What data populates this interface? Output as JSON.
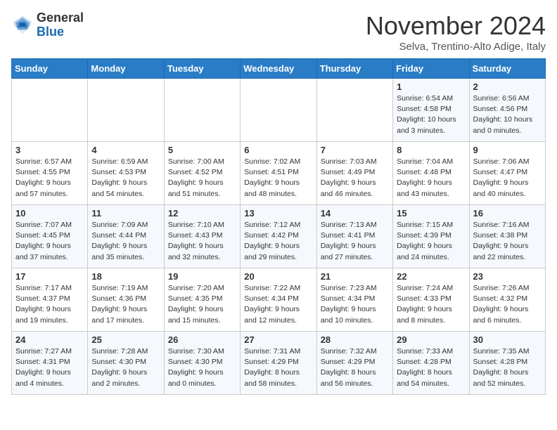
{
  "header": {
    "logo_general": "General",
    "logo_blue": "Blue",
    "month_title": "November 2024",
    "subtitle": "Selva, Trentino-Alto Adige, Italy"
  },
  "weekdays": [
    "Sunday",
    "Monday",
    "Tuesday",
    "Wednesday",
    "Thursday",
    "Friday",
    "Saturday"
  ],
  "weeks": [
    [
      {
        "day": "",
        "info": ""
      },
      {
        "day": "",
        "info": ""
      },
      {
        "day": "",
        "info": ""
      },
      {
        "day": "",
        "info": ""
      },
      {
        "day": "",
        "info": ""
      },
      {
        "day": "1",
        "info": "Sunrise: 6:54 AM\nSunset: 4:58 PM\nDaylight: 10 hours\nand 3 minutes."
      },
      {
        "day": "2",
        "info": "Sunrise: 6:56 AM\nSunset: 4:56 PM\nDaylight: 10 hours\nand 0 minutes."
      }
    ],
    [
      {
        "day": "3",
        "info": "Sunrise: 6:57 AM\nSunset: 4:55 PM\nDaylight: 9 hours\nand 57 minutes."
      },
      {
        "day": "4",
        "info": "Sunrise: 6:59 AM\nSunset: 4:53 PM\nDaylight: 9 hours\nand 54 minutes."
      },
      {
        "day": "5",
        "info": "Sunrise: 7:00 AM\nSunset: 4:52 PM\nDaylight: 9 hours\nand 51 minutes."
      },
      {
        "day": "6",
        "info": "Sunrise: 7:02 AM\nSunset: 4:51 PM\nDaylight: 9 hours\nand 48 minutes."
      },
      {
        "day": "7",
        "info": "Sunrise: 7:03 AM\nSunset: 4:49 PM\nDaylight: 9 hours\nand 46 minutes."
      },
      {
        "day": "8",
        "info": "Sunrise: 7:04 AM\nSunset: 4:48 PM\nDaylight: 9 hours\nand 43 minutes."
      },
      {
        "day": "9",
        "info": "Sunrise: 7:06 AM\nSunset: 4:47 PM\nDaylight: 9 hours\nand 40 minutes."
      }
    ],
    [
      {
        "day": "10",
        "info": "Sunrise: 7:07 AM\nSunset: 4:45 PM\nDaylight: 9 hours\nand 37 minutes."
      },
      {
        "day": "11",
        "info": "Sunrise: 7:09 AM\nSunset: 4:44 PM\nDaylight: 9 hours\nand 35 minutes."
      },
      {
        "day": "12",
        "info": "Sunrise: 7:10 AM\nSunset: 4:43 PM\nDaylight: 9 hours\nand 32 minutes."
      },
      {
        "day": "13",
        "info": "Sunrise: 7:12 AM\nSunset: 4:42 PM\nDaylight: 9 hours\nand 29 minutes."
      },
      {
        "day": "14",
        "info": "Sunrise: 7:13 AM\nSunset: 4:41 PM\nDaylight: 9 hours\nand 27 minutes."
      },
      {
        "day": "15",
        "info": "Sunrise: 7:15 AM\nSunset: 4:39 PM\nDaylight: 9 hours\nand 24 minutes."
      },
      {
        "day": "16",
        "info": "Sunrise: 7:16 AM\nSunset: 4:38 PM\nDaylight: 9 hours\nand 22 minutes."
      }
    ],
    [
      {
        "day": "17",
        "info": "Sunrise: 7:17 AM\nSunset: 4:37 PM\nDaylight: 9 hours\nand 19 minutes."
      },
      {
        "day": "18",
        "info": "Sunrise: 7:19 AM\nSunset: 4:36 PM\nDaylight: 9 hours\nand 17 minutes."
      },
      {
        "day": "19",
        "info": "Sunrise: 7:20 AM\nSunset: 4:35 PM\nDaylight: 9 hours\nand 15 minutes."
      },
      {
        "day": "20",
        "info": "Sunrise: 7:22 AM\nSunset: 4:34 PM\nDaylight: 9 hours\nand 12 minutes."
      },
      {
        "day": "21",
        "info": "Sunrise: 7:23 AM\nSunset: 4:34 PM\nDaylight: 9 hours\nand 10 minutes."
      },
      {
        "day": "22",
        "info": "Sunrise: 7:24 AM\nSunset: 4:33 PM\nDaylight: 9 hours\nand 8 minutes."
      },
      {
        "day": "23",
        "info": "Sunrise: 7:26 AM\nSunset: 4:32 PM\nDaylight: 9 hours\nand 6 minutes."
      }
    ],
    [
      {
        "day": "24",
        "info": "Sunrise: 7:27 AM\nSunset: 4:31 PM\nDaylight: 9 hours\nand 4 minutes."
      },
      {
        "day": "25",
        "info": "Sunrise: 7:28 AM\nSunset: 4:30 PM\nDaylight: 9 hours\nand 2 minutes."
      },
      {
        "day": "26",
        "info": "Sunrise: 7:30 AM\nSunset: 4:30 PM\nDaylight: 9 hours\nand 0 minutes."
      },
      {
        "day": "27",
        "info": "Sunrise: 7:31 AM\nSunset: 4:29 PM\nDaylight: 8 hours\nand 58 minutes."
      },
      {
        "day": "28",
        "info": "Sunrise: 7:32 AM\nSunset: 4:29 PM\nDaylight: 8 hours\nand 56 minutes."
      },
      {
        "day": "29",
        "info": "Sunrise: 7:33 AM\nSunset: 4:28 PM\nDaylight: 8 hours\nand 54 minutes."
      },
      {
        "day": "30",
        "info": "Sunrise: 7:35 AM\nSunset: 4:28 PM\nDaylight: 8 hours\nand 52 minutes."
      }
    ]
  ]
}
